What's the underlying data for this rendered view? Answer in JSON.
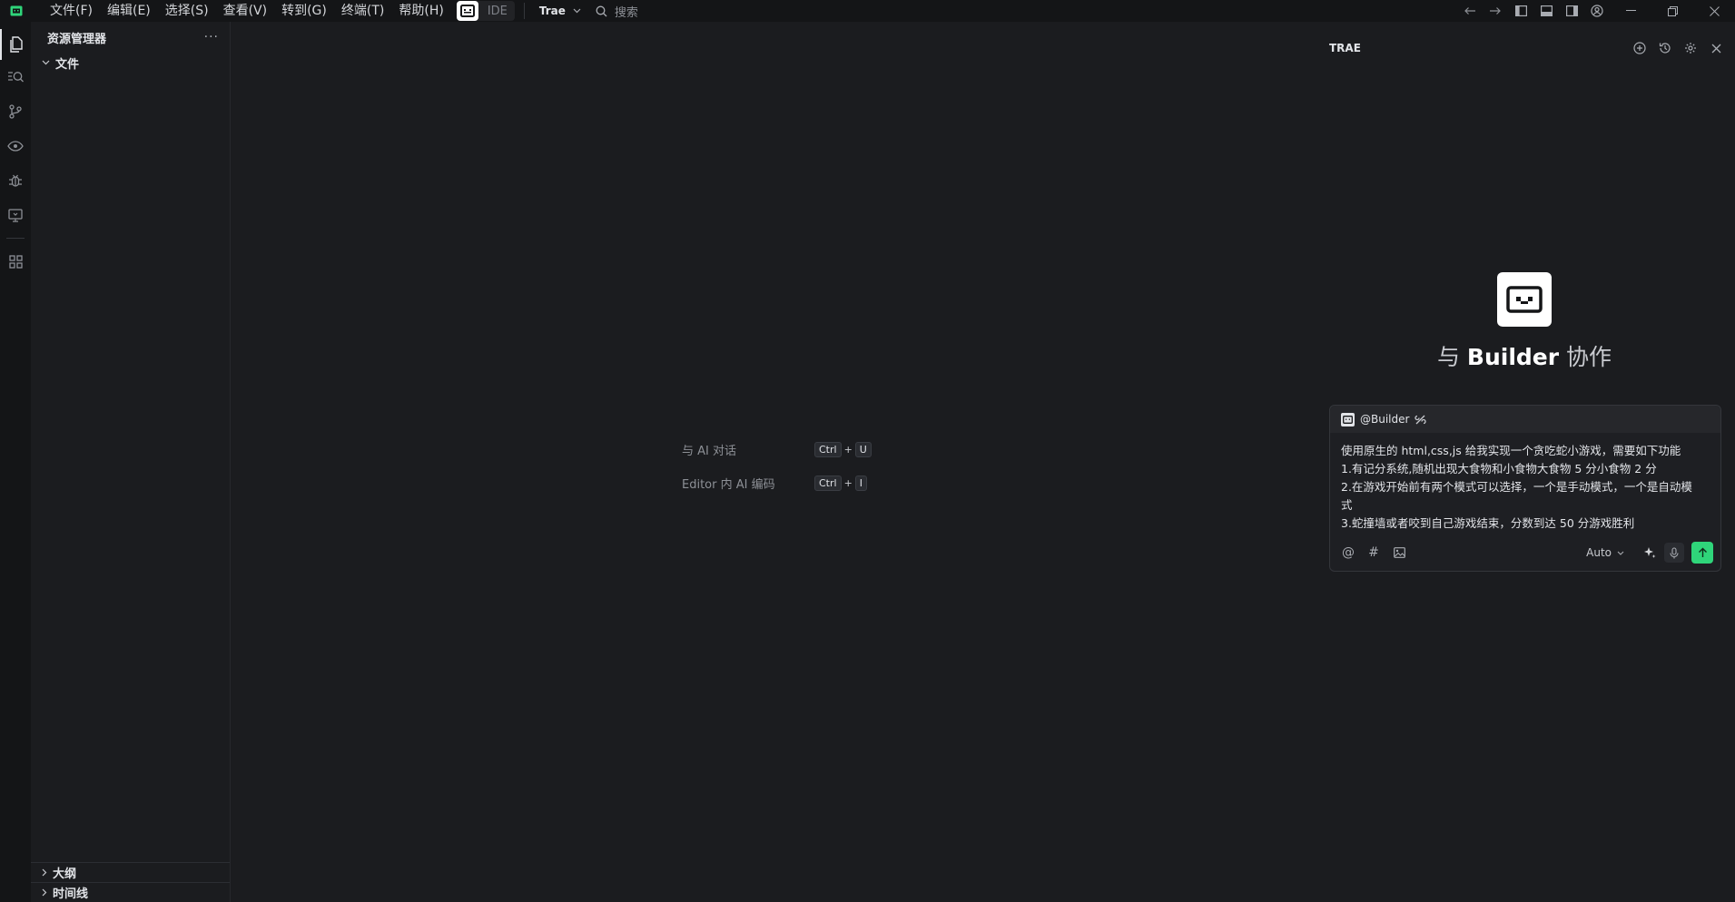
{
  "menu": {
    "items": [
      "文件(F)",
      "编辑(E)",
      "选择(S)",
      "查看(V)",
      "转到(G)",
      "终端(T)",
      "帮助(H)"
    ],
    "ide_label": "IDE",
    "trae_label": "Trae",
    "search_placeholder": "搜索"
  },
  "sidebar": {
    "title": "资源管理器",
    "more": "···",
    "folder": "文件",
    "outline": "大纲",
    "timeline": "时间线"
  },
  "editor": {
    "hints": [
      {
        "label": "与 AI 对话",
        "keys": [
          "Ctrl",
          "U"
        ]
      },
      {
        "label": "Editor 内 AI 编码",
        "keys": [
          "Ctrl",
          "I"
        ]
      }
    ]
  },
  "panel": {
    "title": "TRAE",
    "heading_prefix": "与",
    "heading_name": "Builder",
    "heading_suffix": "协作",
    "context_label": "@Builder",
    "message": "使用原生的 html,css,js 给我实现一个贪吃蛇小游戏，需要如下功能\n1.有记分系统,随机出现大食物和小食物大食物 5 分小食物 2 分\n2.在游戏开始前有两个模式可以选择，一个是手动模式，一个是自动模\n式\n3.蛇撞墙或者咬到自己游戏结束，分数到达 50 分游戏胜利",
    "tool_at": "@",
    "tool_hash": "#",
    "model": "Auto"
  },
  "colors": {
    "accent": "#2fd57a",
    "background": "#1b1c1f",
    "titlebar": "#141517"
  }
}
